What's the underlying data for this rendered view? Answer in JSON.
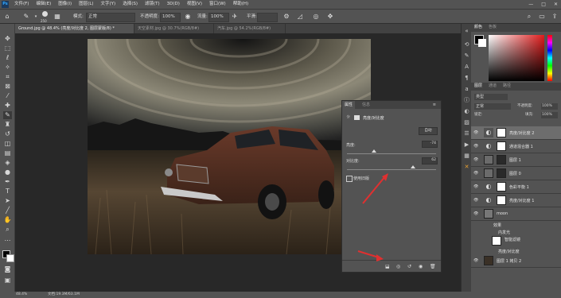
{
  "app": {
    "logo": "Ps"
  },
  "menu": [
    "文件(F)",
    "编辑(E)",
    "图像(I)",
    "图层(L)",
    "文字(Y)",
    "选择(S)",
    "滤镜(T)",
    "3D(D)",
    "视图(V)",
    "窗口(W)",
    "帮助(H)"
  ],
  "options": {
    "brush_size": "250",
    "mode_label": "模式:",
    "mode_value": "正常",
    "opacity_label": "不透明度:",
    "opacity_value": "100%",
    "flow_label": "流量:",
    "flow_value": "100%",
    "smooth_label": "平滑:",
    "smooth_value": ""
  },
  "tabs": [
    {
      "label": "Ground.jpg @ 48.4% (亮度/对比度 2, 图层蒙版/8) *"
    },
    {
      "label": "天空素材.jpg @ 30.7%(RGB/8#)"
    },
    {
      "label": "汽车.jpg @ 54.2%(RGB/8#)"
    }
  ],
  "properties": {
    "tab_properties": "属性",
    "tab_info": "信息",
    "adjustment_name": "亮度/对比度",
    "auto_button": "自动",
    "brightness_label": "亮度:",
    "brightness_value": "-74",
    "contrast_label": "对比度:",
    "contrast_value": "62",
    "legacy_label": "使用旧版",
    "brightness_pct": 0.3,
    "contrast_pct": 0.74
  },
  "color_panel": {
    "tab_color": "颜色",
    "tab_swatches": "色板"
  },
  "layers_panel": {
    "tab_layers": "图层",
    "tab_channels": "通道",
    "tab_paths": "路径",
    "kind_label": "类型",
    "blend_mode": "正常",
    "opacity_label": "不透明度:",
    "opacity_value": "100%",
    "lock_label": "锁定:",
    "fill_label": "填充:",
    "fill_value": "100%",
    "layers": [
      {
        "name": "亮度/对比度 2",
        "type": "adjust",
        "selected": true
      },
      {
        "name": "通道混合器 1",
        "type": "adjust"
      },
      {
        "name": "图层 1",
        "type": "dark"
      },
      {
        "name": "图层 0",
        "type": "dark"
      },
      {
        "name": "色彩平衡 1",
        "type": "adjust"
      },
      {
        "name": "亮度/对比度 1",
        "type": "adjust"
      },
      {
        "name": "moon",
        "type": "moon"
      },
      {
        "name": "效果",
        "type": "sub"
      },
      {
        "name": "内发光",
        "type": "sub2"
      },
      {
        "name": "智能滤镜",
        "type": "smart"
      },
      {
        "name": "亮度/对比度",
        "type": "sub2"
      },
      {
        "name": "图层 1 拷贝 2",
        "type": "car"
      }
    ]
  },
  "status": {
    "zoom": "48.4%",
    "doc": "文档:19.3M/63.1M"
  },
  "colors": {
    "accent": "#31a8ff",
    "arrow": "#e03030"
  }
}
